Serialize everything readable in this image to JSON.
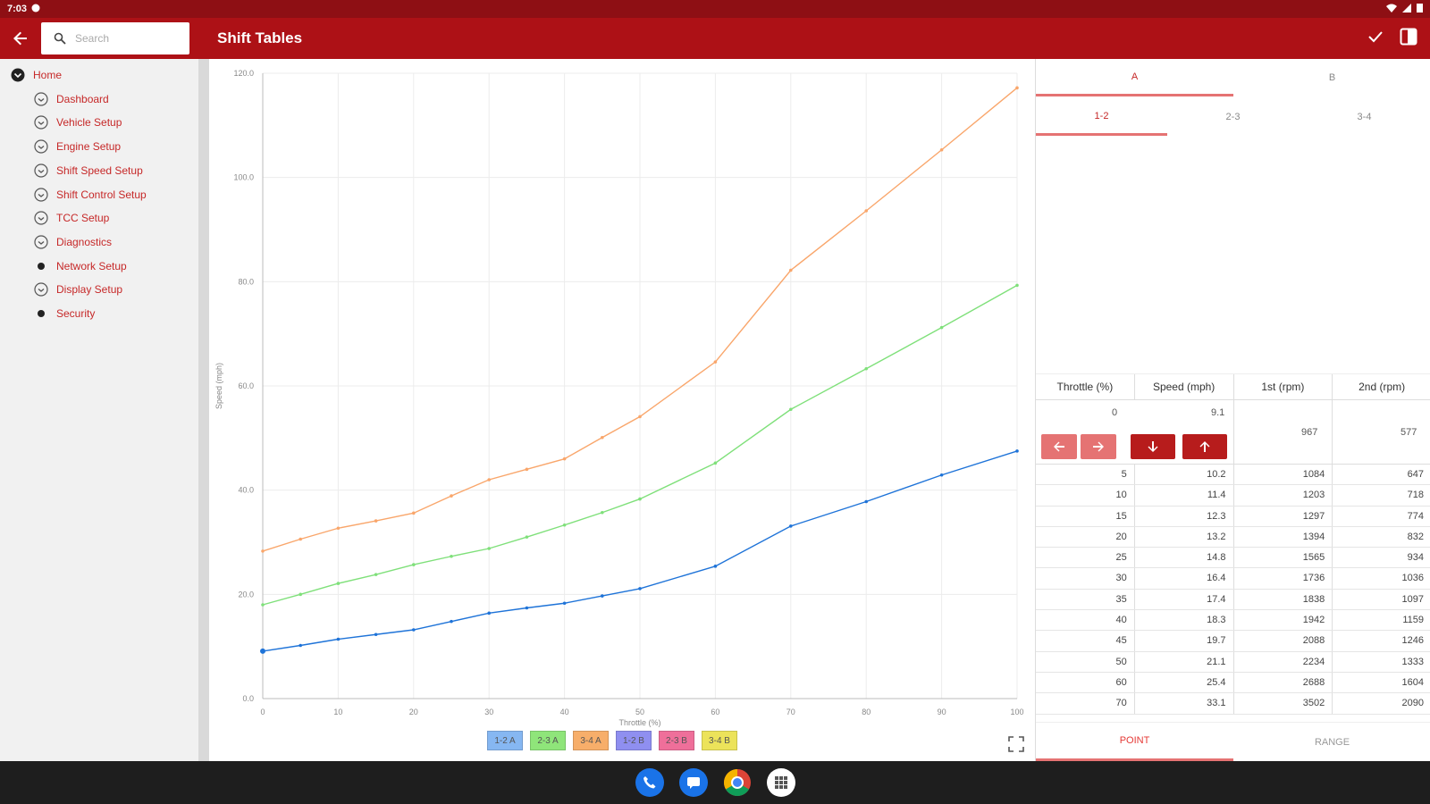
{
  "status_bar": {
    "time": "7:03"
  },
  "app_bar": {
    "title": "Shift Tables",
    "search_placeholder": "Search"
  },
  "sidebar": {
    "items": [
      {
        "label": "Home",
        "icon": "chevron-down-circle-icon"
      },
      {
        "label": "Dashboard",
        "icon": "chevron-circle-icon"
      },
      {
        "label": "Vehicle Setup",
        "icon": "chevron-circle-icon"
      },
      {
        "label": "Engine Setup",
        "icon": "chevron-circle-icon"
      },
      {
        "label": "Shift Speed Setup",
        "icon": "chevron-circle-icon"
      },
      {
        "label": "Shift Control Setup",
        "icon": "chevron-circle-icon"
      },
      {
        "label": "TCC Setup",
        "icon": "chevron-circle-icon"
      },
      {
        "label": "Diagnostics",
        "icon": "chevron-circle-icon"
      },
      {
        "label": "Network Setup",
        "icon": "dot-icon"
      },
      {
        "label": "Display Setup",
        "icon": "chevron-circle-icon"
      },
      {
        "label": "Security",
        "icon": "dot-icon"
      }
    ]
  },
  "legend": {
    "items": [
      {
        "label": "1-2 A",
        "color": "#86b7f2"
      },
      {
        "label": "2-3 A",
        "color": "#8fe57a"
      },
      {
        "label": "3-4 A",
        "color": "#f7ae6a"
      },
      {
        "label": "1-2 B",
        "color": "#8f8ff0"
      },
      {
        "label": "2-3 B",
        "color": "#ef6f9a"
      },
      {
        "label": "3-4 B",
        "color": "#ece35a"
      }
    ]
  },
  "chart_data": {
    "type": "line",
    "xlabel": "Throttle (%)",
    "ylabel": "Speed (mph)",
    "xlim": [
      0,
      100
    ],
    "ylim": [
      0,
      120
    ],
    "x_ticks": [
      "0",
      "10",
      "20",
      "30",
      "40",
      "50",
      "60",
      "70",
      "80",
      "90",
      "100"
    ],
    "y_ticks": [
      "0.0",
      "20.0",
      "40.0",
      "60.0",
      "80.0",
      "100.0",
      "120.0"
    ],
    "grid": true,
    "x": [
      0,
      5,
      10,
      15,
      20,
      25,
      30,
      35,
      40,
      45,
      50,
      60,
      70,
      80,
      90,
      100
    ],
    "series": [
      {
        "values": [
          9.1,
          10.2,
          11.4,
          12.3,
          13.2,
          14.8,
          16.4,
          17.4,
          18.3,
          19.7,
          21.1,
          25.4,
          33.1,
          37.8,
          42.9,
          47.5
        ],
        "color": "#1e73d8"
      },
      {
        "values": [
          18.0,
          20.0,
          22.1,
          23.8,
          25.7,
          27.3,
          28.8,
          31.0,
          33.3,
          35.7,
          38.3,
          45.2,
          55.5,
          63.3,
          71.2,
          79.3
        ],
        "color": "#7fe07a"
      },
      {
        "values": [
          28.3,
          30.6,
          32.7,
          34.1,
          35.6,
          38.9,
          42.0,
          44.0,
          46.0,
          50.1,
          54.1,
          64.6,
          82.2,
          93.6,
          105.3,
          117.2
        ],
        "color": "#f9a66b"
      }
    ]
  },
  "right_panel": {
    "top_tabs": [
      "A",
      "B"
    ],
    "sub_tabs": [
      "1-2",
      "2-3",
      "3-4"
    ],
    "columns": [
      "Throttle (%)",
      "Speed (mph)",
      "1st (rpm)",
      "2nd (rpm)"
    ],
    "first_row": {
      "throttle": "0",
      "speed": "9.1",
      "rpm1": "967",
      "rpm2": "577"
    },
    "rows": [
      [
        "5",
        "10.2",
        "1084",
        "647"
      ],
      [
        "10",
        "11.4",
        "1203",
        "718"
      ],
      [
        "15",
        "12.3",
        "1297",
        "774"
      ],
      [
        "20",
        "13.2",
        "1394",
        "832"
      ],
      [
        "25",
        "14.8",
        "1565",
        "934"
      ],
      [
        "30",
        "16.4",
        "1736",
        "1036"
      ],
      [
        "35",
        "17.4",
        "1838",
        "1097"
      ],
      [
        "40",
        "18.3",
        "1942",
        "1159"
      ],
      [
        "45",
        "19.7",
        "2088",
        "1246"
      ],
      [
        "50",
        "21.1",
        "2234",
        "1333"
      ],
      [
        "60",
        "25.4",
        "2688",
        "1604"
      ],
      [
        "70",
        "33.1",
        "3502",
        "2090"
      ]
    ],
    "bottom_tabs": [
      "POINT",
      "RANGE"
    ]
  }
}
